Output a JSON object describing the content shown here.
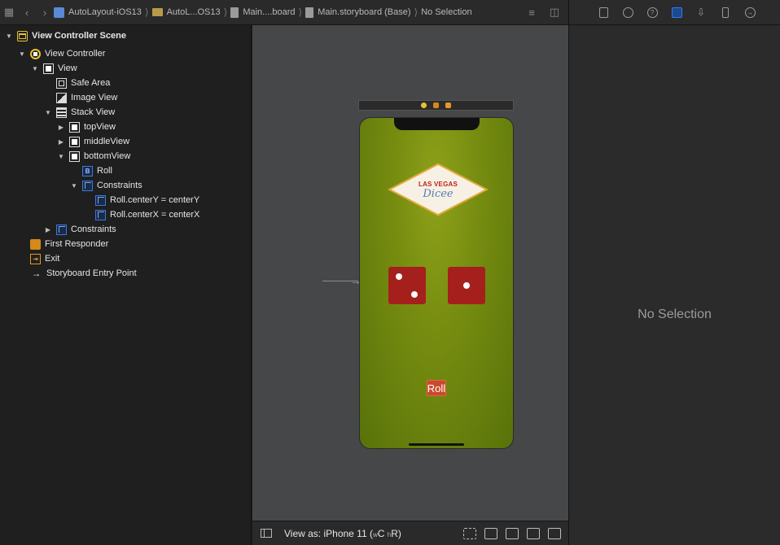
{
  "jumpbar": {
    "crumbs": [
      {
        "label": "AutoLayout-iOS13",
        "icon": "project-icon"
      },
      {
        "label": "AutoL...OS13",
        "icon": "folder-icon"
      },
      {
        "label": "Main....board",
        "icon": "storyboard-file-icon"
      },
      {
        "label": "Main.storyboard (Base)",
        "icon": "storyboard-file-icon"
      },
      {
        "label": "No Selection",
        "icon": ""
      }
    ]
  },
  "outline": {
    "scene": "View Controller Scene",
    "view_controller": "View Controller",
    "view": "View",
    "safe_area": "Safe Area",
    "image_view": "Image View",
    "stack_view": "Stack View",
    "top_view": "topView",
    "middle_view": "middleView",
    "bottom_view": "bottomView",
    "roll": "Roll",
    "constraints_inner": "Constraints",
    "constraint_y": "Roll.centerY = centerY",
    "constraint_x": "Roll.centerX = centerX",
    "constraints_outer": "Constraints",
    "first_responder": "First Responder",
    "exit": "Exit",
    "entry_point": "Storyboard Entry Point",
    "button_badge": "B"
  },
  "canvas": {
    "logo_top": "LAS VEGAS",
    "logo_bottom": "Dicee",
    "roll_button": "Roll",
    "colors": {
      "background": "#464749",
      "felt": "#768c10",
      "die": "#a5201c",
      "roll_button": "#c84a2c"
    }
  },
  "bottombar": {
    "view_as_prefix": "View as: iPhone 11 (",
    "size_w": "w",
    "size_c": "C",
    "size_h": "h",
    "size_r": "R)"
  },
  "inspector": {
    "no_selection": "No Selection"
  }
}
